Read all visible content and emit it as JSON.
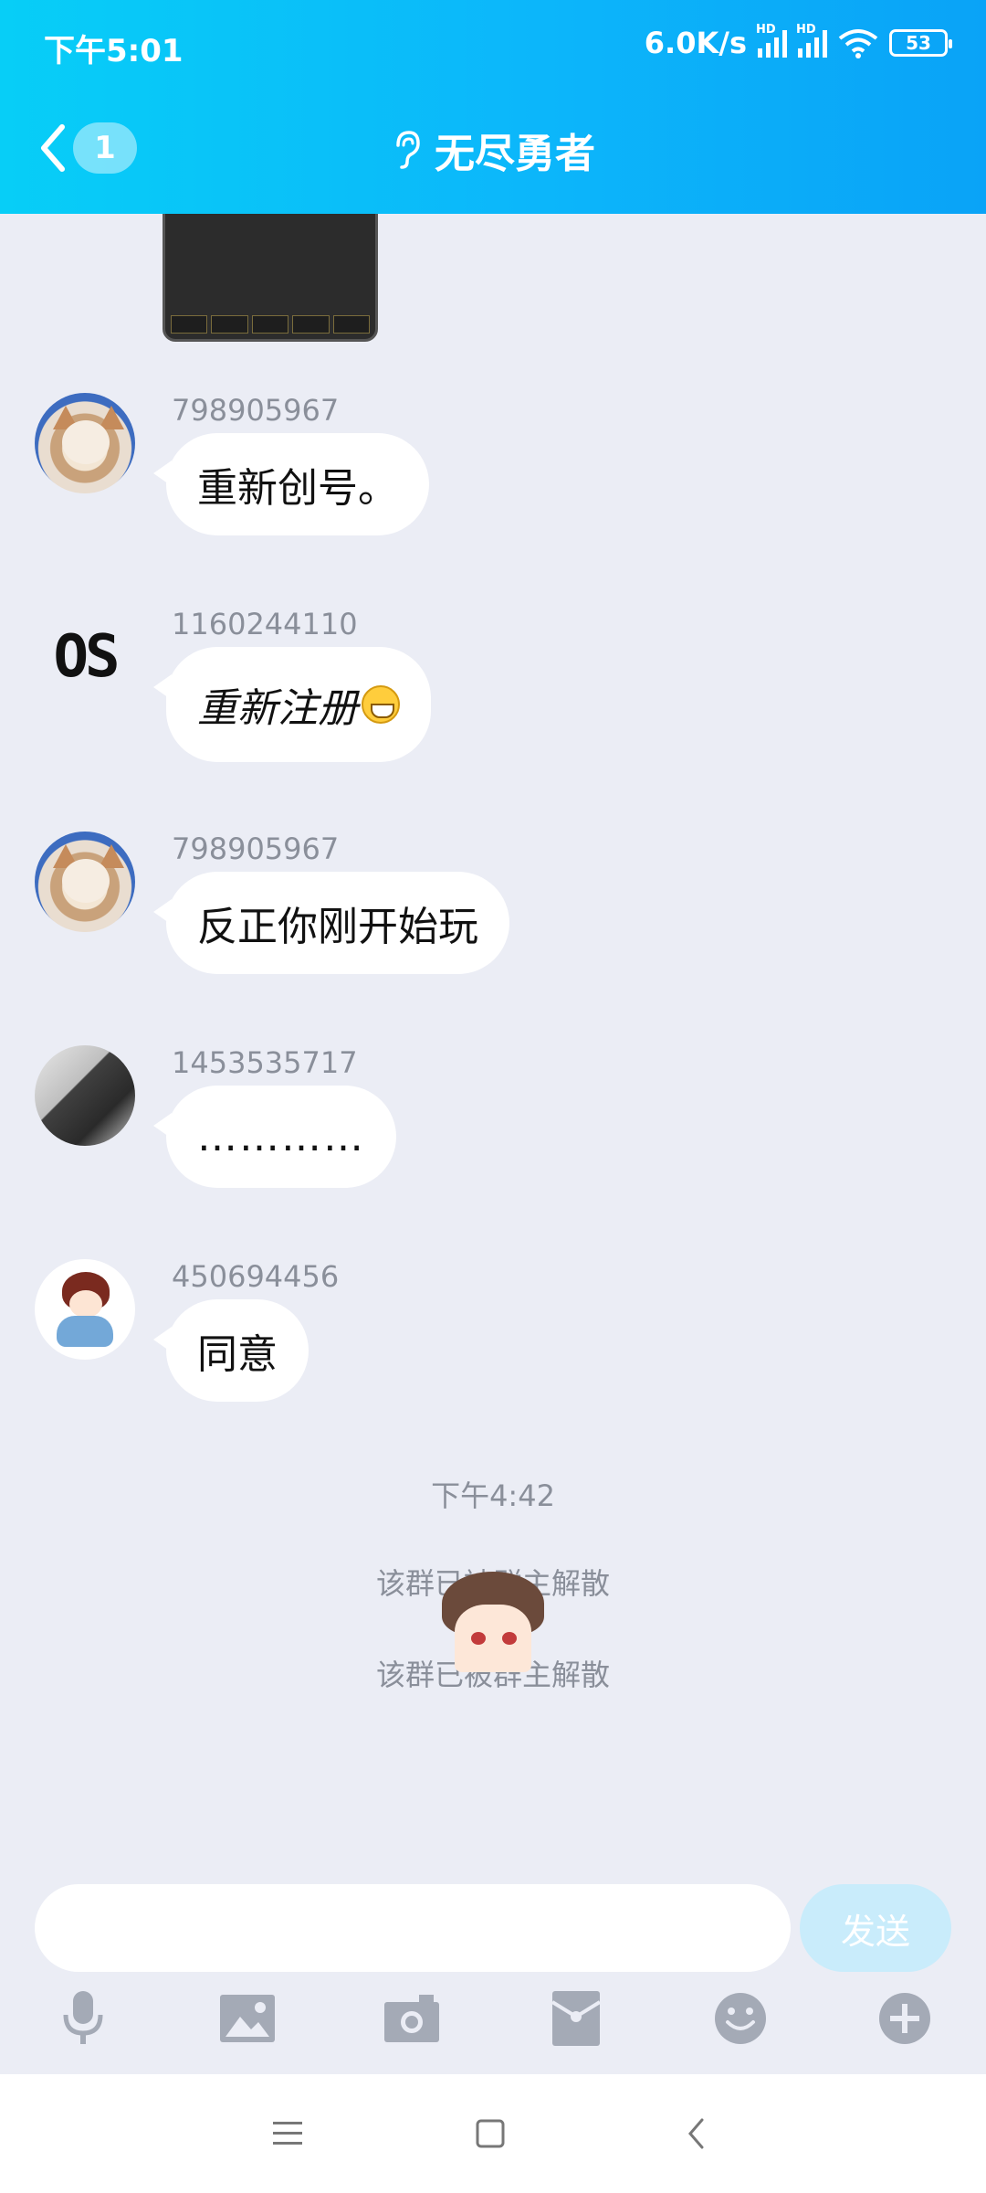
{
  "status": {
    "time": "下午5:01",
    "net_speed": "6.0K/s",
    "hd1": "HD",
    "hd2": "HD",
    "battery": "53"
  },
  "header": {
    "back_count": "1",
    "title": "无尽勇者",
    "icons": {
      "back": "chevron-left-icon",
      "ear": "ear-icon"
    }
  },
  "messages": [
    {
      "sender": "798905967",
      "text": "重新创号。",
      "avatar": "cat-avatar"
    },
    {
      "sender": "1160244110",
      "text": "重新注册",
      "avatar": "os-avatar"
    },
    {
      "sender": "798905967",
      "text": "反正你刚开始玩",
      "avatar": "cat-avatar"
    },
    {
      "sender": "1453535717",
      "text": "…………",
      "avatar": "boy-avatar"
    },
    {
      "sender": "450694456",
      "text": "同意",
      "avatar": "anime-avatar"
    }
  ],
  "avatar_text": {
    "os": "OS"
  },
  "system": {
    "timestamp": "下午4:42",
    "notice1": "该群已被群主解散",
    "notice2": "该群已被群主解散"
  },
  "input": {
    "placeholder": "",
    "send_label": "发送"
  },
  "toolbar": [
    "microphone-icon",
    "image-icon",
    "camera-icon",
    "red-packet-icon",
    "emoji-icon",
    "plus-icon"
  ],
  "colors": {
    "header_start": "#07cef7",
    "header_end": "#0aa3f7",
    "background": "#ebedf5",
    "send_disabled": "#c9ecfb"
  }
}
